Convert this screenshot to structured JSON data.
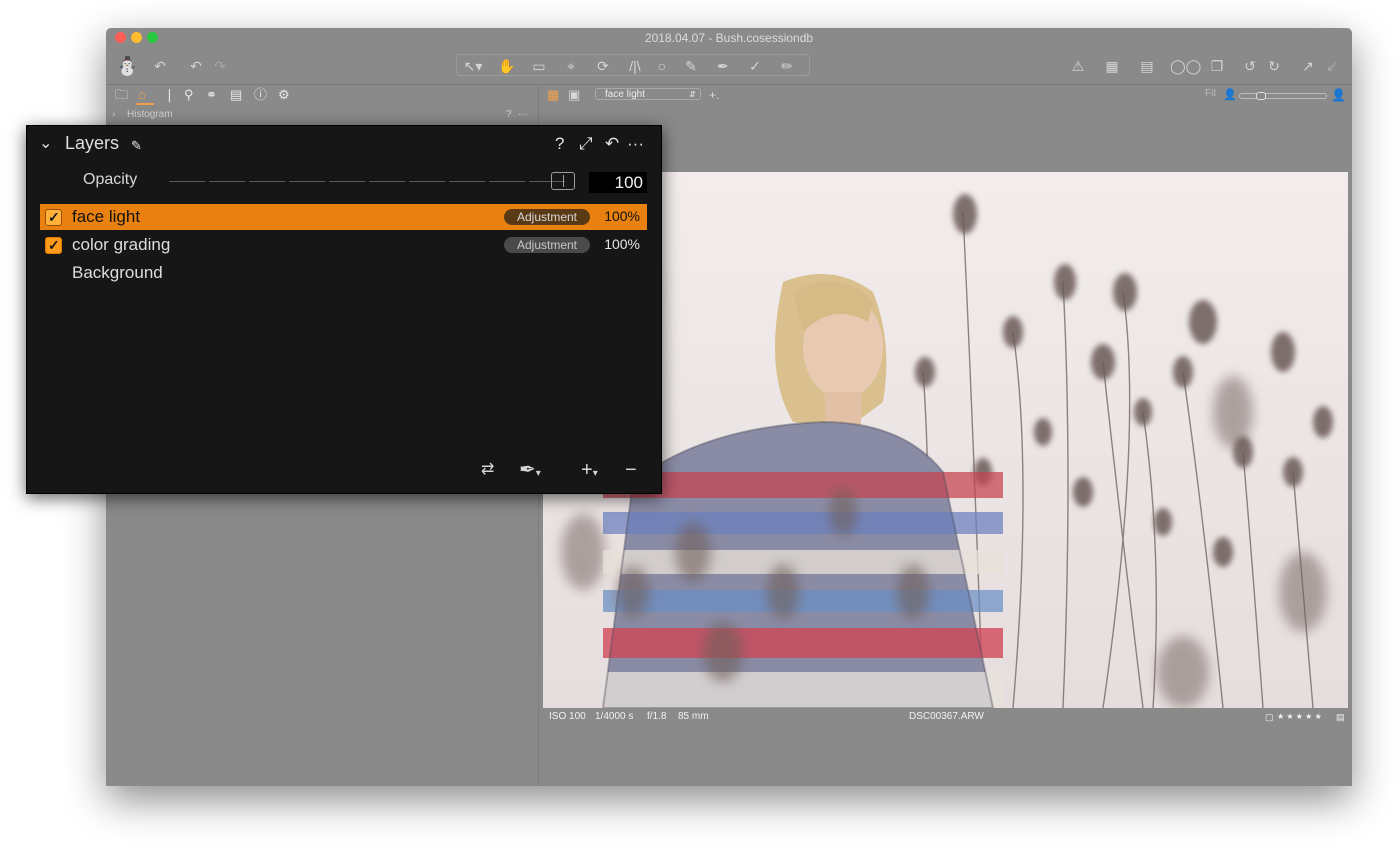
{
  "window": {
    "title": "2018.04.07 - Bush.cosessiondb",
    "traffic_lights": [
      "#fe5f57",
      "#febc2e",
      "#28c840"
    ]
  },
  "toolbar": {
    "left_icons": [
      "app-icon",
      "undo-arrow-icon",
      "undo-icon",
      "redo-icon"
    ],
    "center_icons": [
      "cursor-tool-icon",
      "hand-tool-icon",
      "stamp-tool-icon",
      "crop-tool-icon",
      "rotate-tool-icon",
      "keystone-tool-icon",
      "circle-tool-icon",
      "brush-tool-icon",
      "eyedropper-tool-icon",
      "pipette-tool-icon",
      "eraser-tool-icon"
    ],
    "right_icons": [
      "warning-icon",
      "grid-icon",
      "overlay-icon",
      "glasses-icon",
      "clone-icon",
      "rotate-left-icon",
      "rotate-right-icon",
      "export-icon",
      "process-icon"
    ]
  },
  "left_panel": {
    "tabs": [
      "library-tab",
      "adjust-tab",
      "lens-tab",
      "search-tab",
      "color-tab",
      "details-tab",
      "metadata-tab",
      "settings-tab"
    ],
    "active_tab": 1,
    "histogram_label": "Histogram",
    "histogram_help": "?",
    "histogram_more": "···"
  },
  "viewer": {
    "layer_select": "face light",
    "add_label": "+.",
    "fit_label": "Fit",
    "zoom_level": 0.2,
    "info": {
      "iso": "ISO 100",
      "shutter": "1/4000 s",
      "aperture": "f/1.8",
      "focal": "85 mm",
      "filename": "DSC00367.ARW",
      "stars": "★ ★ ★ ★ ★"
    }
  },
  "layers_panel": {
    "title": "Layers",
    "help": "?",
    "more": "···",
    "opacity_label": "Opacity",
    "opacity_value": "100",
    "layers": [
      {
        "name": "face light",
        "kind": "Adjustment",
        "opacity": "100%",
        "checked": true,
        "selected": true
      },
      {
        "name": "color grading",
        "kind": "Adjustment",
        "opacity": "100%",
        "checked": true,
        "selected": false
      },
      {
        "name": "Background",
        "kind": "",
        "opacity": "",
        "checked": false,
        "selected": false
      }
    ],
    "accent_color": "#e8810f"
  }
}
